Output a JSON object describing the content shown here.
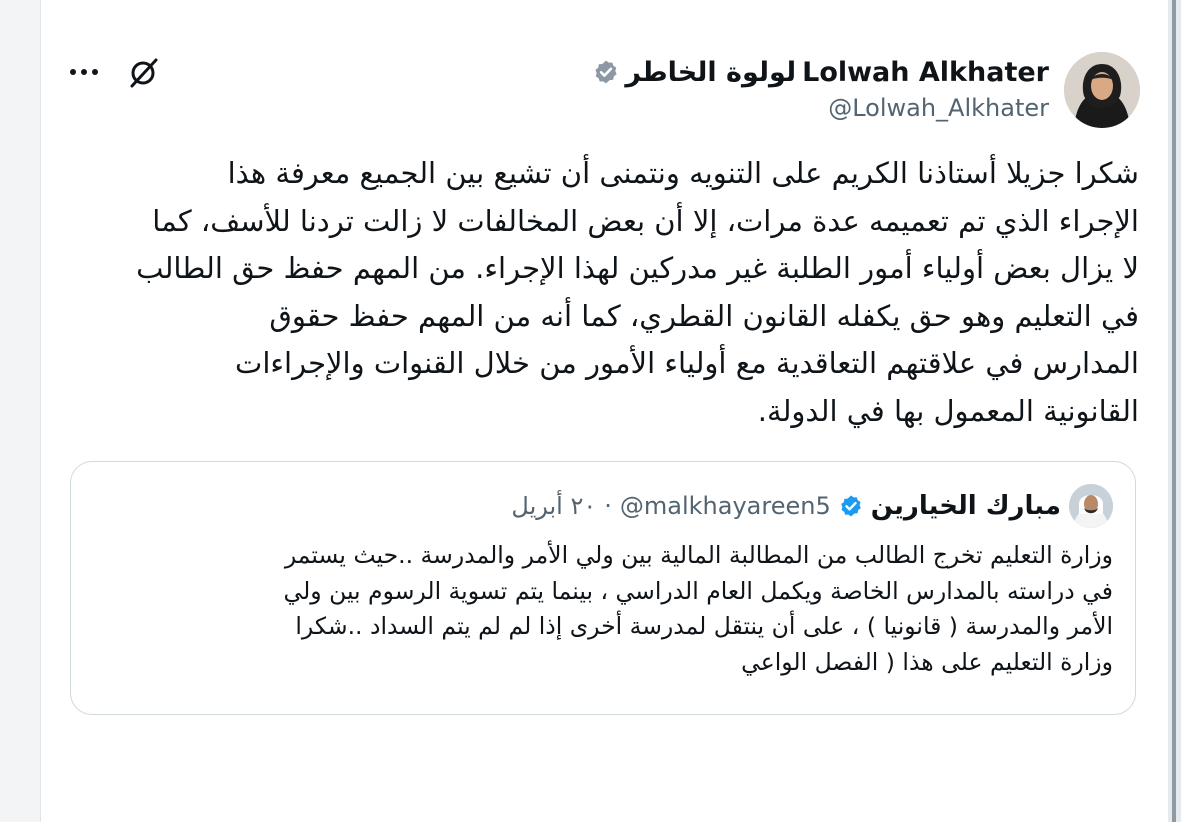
{
  "author": {
    "name_en": "Lolwah Alkhater",
    "name_ar": "لولوة الخاطر",
    "handle": "@Lolwah_Alkhater"
  },
  "tweet": {
    "lines": [
      "شكرا جزيلا أستاذنا الكريم على التنويه ونتمنى أن تشيع بين الجميع معرفة هذا",
      "الإجراء الذي تم تعميمه عدة مرات، إلا أن بعض المخالفات لا زالت تردنا للأسف، كما",
      "لا يزال بعض أولياء أمور الطلبة غير مدركين لهذا الإجراء. من المهم حفظ حق الطالب",
      "في التعليم وهو حق يكفله القانون القطري، كما أنه من المهم حفظ حقوق",
      "المدارس في علاقتهم التعاقدية مع أولياء الأمور من خلال القنوات والإجراءات",
      "القانونية المعمول بها في الدولة."
    ]
  },
  "quote": {
    "name": "مبارك الخيارين",
    "handle": "@malkhayareen5",
    "separator": "·",
    "date": "٢٠ أبريل",
    "lines": [
      "وزارة التعليم تخرج الطالب من المطالبة المالية بين ولي الأمر والمدرسة ..حيث يستمر",
      "في دراسته بالمدارس الخاصة ويكمل العام الدراسي ، بينما يتم تسوية الرسوم بين ولي",
      "الأمر والمدرسة ( قانونيا ) ، على أن ينتقل لمدرسة أخرى إذا لم لم يتم السداد ..شكرا",
      "وزارة التعليم على هذا ( الفصل الواعي"
    ]
  },
  "icons": {
    "verified": "verified-badge-icon",
    "more": "more-options-icon",
    "no_link": "unlink-icon"
  },
  "colors": {
    "verified": "#1d9bf0",
    "text": "#0f1419",
    "muted": "#536471",
    "border": "#cfd9de"
  }
}
